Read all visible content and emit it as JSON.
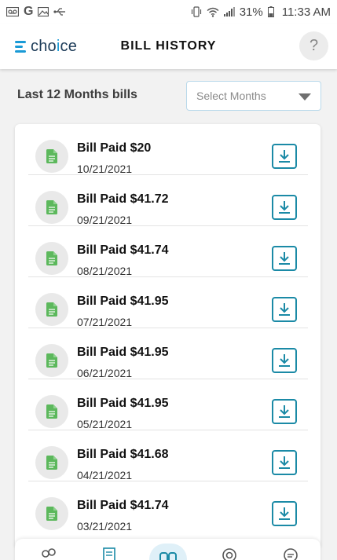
{
  "status_bar": {
    "battery": "31%",
    "time": "11:33 AM"
  },
  "header": {
    "logo_text_start": "cho",
    "logo_text_i": "i",
    "logo_text_end": "ce",
    "title": "BILL HISTORY",
    "help_label": "?"
  },
  "filter": {
    "label": "Last 12 Months bills",
    "select_placeholder": "Select Months"
  },
  "bills": [
    {
      "title": "Bill Paid $20",
      "date": "10/21/2021"
    },
    {
      "title": "Bill Paid $41.72",
      "date": "09/21/2021"
    },
    {
      "title": "Bill Paid $41.74",
      "date": "08/21/2021"
    },
    {
      "title": "Bill Paid $41.95",
      "date": "07/21/2021"
    },
    {
      "title": "Bill Paid $41.95",
      "date": "06/21/2021"
    },
    {
      "title": "Bill Paid $41.95",
      "date": "05/21/2021"
    },
    {
      "title": "Bill Paid $41.68",
      "date": "04/21/2021"
    },
    {
      "title": "Bill Paid $41.74",
      "date": "03/21/2021"
    }
  ],
  "icons": {
    "bill_doc": "document-icon",
    "download": "download-icon",
    "nav": [
      "community-icon",
      "bills-icon",
      "dashboard-icon",
      "location-icon",
      "chat-icon"
    ]
  },
  "colors": {
    "brand_blue": "#1a9ad6",
    "brand_navy": "#1b3a57",
    "doc_green": "#5cb85c",
    "download_teal": "#1b8aa6"
  }
}
